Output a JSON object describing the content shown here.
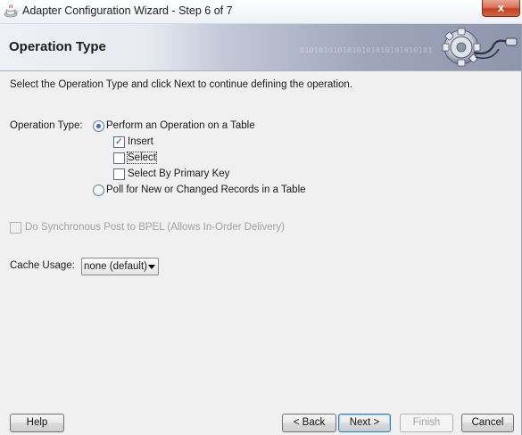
{
  "window": {
    "title": "Adapter Configuration Wizard - Step 6 of 7",
    "close_label": "x"
  },
  "header": {
    "title": "Operation Type",
    "binary_decoration": "0101010101010101010101010101"
  },
  "instructions": "Select the Operation Type and click Next to continue defining the operation.",
  "operation": {
    "label": "Operation Type:",
    "table_option": {
      "label": "Perform an Operation on a Table",
      "selected": true
    },
    "checkboxes": [
      {
        "label": "Insert",
        "checked": true
      },
      {
        "label": "Select",
        "checked": false
      },
      {
        "label": "Select By Primary Key",
        "checked": false
      }
    ],
    "poll_option": {
      "label": "Poll for New or Changed Records in a Table",
      "selected": false
    }
  },
  "sync_post": {
    "label": "Do Synchronous Post to BPEL (Allows In-Order Delivery)",
    "checked": false,
    "enabled": false
  },
  "cache": {
    "label": "Cache Usage:",
    "value": "none (default)"
  },
  "buttons": {
    "help": "Help",
    "back": "< Back",
    "next": "Next >",
    "finish": "Finish",
    "cancel": "Cancel"
  },
  "colors": {
    "accent_radio": "#3d6eb8",
    "check": "#1d4fa0",
    "close": "#c53f1c"
  }
}
